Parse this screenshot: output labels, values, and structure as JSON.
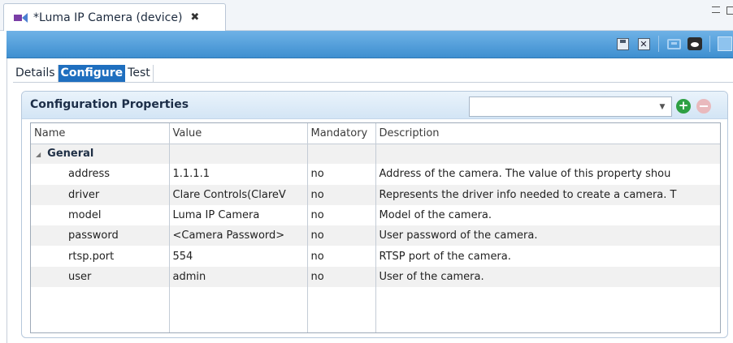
{
  "editor": {
    "tab_title": "*Luma IP Camera (device)",
    "tab_icon": "camera-icon"
  },
  "toolbar": {
    "icons": [
      "save-icon",
      "save-all-icon",
      "connect-icon",
      "preview-icon",
      "settings-icon"
    ]
  },
  "subtabs": [
    {
      "label": "Details",
      "active": false
    },
    {
      "label": "Configure",
      "active": true
    },
    {
      "label": "Test",
      "active": false
    }
  ],
  "section": {
    "title": "Configuration Properties",
    "combo_value": ""
  },
  "table": {
    "columns": [
      "Name",
      "Value",
      "Mandatory",
      "Description"
    ],
    "group": "General",
    "rows": [
      {
        "name": "address",
        "value": "1.1.1.1",
        "mandatory": "no",
        "description": "Address of the camera. The value of this property shou"
      },
      {
        "name": "driver",
        "value": "Clare Controls(ClareV",
        "mandatory": "no",
        "description": "Represents the driver info needed to create a camera. T"
      },
      {
        "name": "model",
        "value": "Luma IP Camera",
        "mandatory": "no",
        "description": "Model of the camera."
      },
      {
        "name": "password",
        "value": "<Camera Password>",
        "mandatory": "no",
        "description": "User password of the camera."
      },
      {
        "name": "rtsp.port",
        "value": "554",
        "mandatory": "no",
        "description": "RTSP port of the camera."
      },
      {
        "name": "user",
        "value": "admin",
        "mandatory": "no",
        "description": "User of the camera."
      }
    ]
  },
  "colors": {
    "toolbar_blue": "#3e8fd0",
    "active_tab": "#1f6fbf",
    "add_green": "#2ea043",
    "remove_pink": "#e9b9bd"
  }
}
